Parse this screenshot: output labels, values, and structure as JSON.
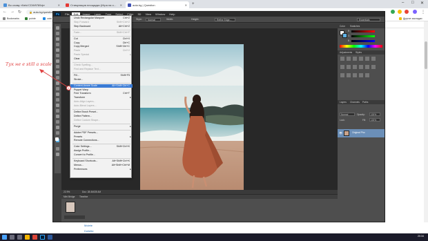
{
  "browser": {
    "tabs": [
      {
        "label": "Во славу «Nelo’CDW9789ф»",
        "color": "#4a90d9"
      },
      {
        "label": "Стимуляция площадки (Игра на о…",
        "color": "#e53935"
      },
      {
        "label": "auta.bg | Question",
        "color": "#3f51b5"
      }
    ],
    "new_tab": "+",
    "address": "auta.bg/question",
    "bookmarks": [
      {
        "label": "Bookmarks",
        "color": "#888888"
      },
      {
        "label": "pointe",
        "color": "#2e7d32"
      },
      {
        "label": "cata",
        "color": "#1e88e5"
      }
    ],
    "other_bookmarks": "Другие закладки"
  },
  "photoshop": {
    "logo": "Ps",
    "menu": [
      "File",
      "Edit",
      "Image",
      "Layer",
      "Type",
      "Select",
      "Filter",
      "3D",
      "View",
      "Window",
      "Help"
    ],
    "active_menu": "Edit",
    "options": {
      "style_label": "Style:",
      "style_value": "Normal",
      "width_label": "Width:",
      "height_label": "Height:",
      "refine_edge": "Refine Edge...",
      "workspace": "Essentials"
    },
    "status": {
      "zoom": "22.9%",
      "doc": "Doc: 28.4M/28.4M"
    },
    "bottom_tabs": [
      "Mini Bridge",
      "Timeline"
    ],
    "right_panels": {
      "color_tabs": [
        "Color",
        "Swatches"
      ],
      "rgb_values": [
        "R",
        "G",
        "B"
      ],
      "adjust_tabs": [
        "Adjustments",
        "Styles"
      ],
      "layers_tabs": [
        "Layers",
        "Channels",
        "Paths"
      ],
      "blend_mode": "Normal",
      "opacity_label": "Opacity:",
      "opacity_value": "100%",
      "lock_label": "Lock:",
      "fill_label": "Fill:",
      "fill_value": "100%",
      "layer_name": "Original Pho"
    },
    "edit_menu": [
      {
        "label": "Undo Rectangular Marquee",
        "shortcut": "Ctrl+Z",
        "state": "normal"
      },
      {
        "label": "Step Forward",
        "shortcut": "Shift+Ctrl+Z",
        "state": "disabled"
      },
      {
        "label": "Step Backward",
        "shortcut": "Alt+Ctrl+Z",
        "state": "normal"
      },
      {
        "sep": true
      },
      {
        "label": "Fade...",
        "shortcut": "Shift+Ctrl+F",
        "state": "disabled"
      },
      {
        "sep": true
      },
      {
        "label": "Cut",
        "shortcut": "Ctrl+X",
        "state": "normal"
      },
      {
        "label": "Copy",
        "shortcut": "Ctrl+C",
        "state": "normal"
      },
      {
        "label": "Copy Merged",
        "shortcut": "Shift+Ctrl+C",
        "state": "normal"
      },
      {
        "label": "Paste",
        "shortcut": "Ctrl+V",
        "state": "disabled"
      },
      {
        "label": "Paste Special",
        "shortcut": "",
        "state": "disabled",
        "submenu": true
      },
      {
        "label": "Clear",
        "shortcut": "",
        "state": "normal"
      },
      {
        "sep": true
      },
      {
        "label": "Check Spelling...",
        "shortcut": "",
        "state": "disabled"
      },
      {
        "label": "Find and Replace Text...",
        "shortcut": "",
        "state": "disabled"
      },
      {
        "sep": true
      },
      {
        "label": "Fill...",
        "shortcut": "Shift+F5",
        "state": "normal"
      },
      {
        "label": "Stroke...",
        "shortcut": "",
        "state": "normal"
      },
      {
        "sep": true
      },
      {
        "label": "Content-Aware Scale",
        "shortcut": "Alt+Shift+Ctrl+C",
        "state": "highlight"
      },
      {
        "label": "Puppet Warp",
        "shortcut": "",
        "state": "normal"
      },
      {
        "label": "Free Transform",
        "shortcut": "Ctrl+T",
        "state": "normal"
      },
      {
        "label": "Transform",
        "shortcut": "",
        "state": "normal",
        "submenu": true
      },
      {
        "label": "Auto-Align Layers...",
        "shortcut": "",
        "state": "disabled"
      },
      {
        "label": "Auto-Blend Layers...",
        "shortcut": "",
        "state": "disabled"
      },
      {
        "sep": true
      },
      {
        "label": "Define Brush Preset...",
        "shortcut": "",
        "state": "normal"
      },
      {
        "label": "Define Pattern...",
        "shortcut": "",
        "state": "normal"
      },
      {
        "label": "Define Custom Shape...",
        "shortcut": "",
        "state": "disabled"
      },
      {
        "sep": true
      },
      {
        "label": "Purge",
        "shortcut": "",
        "state": "normal",
        "submenu": true
      },
      {
        "sep": true
      },
      {
        "label": "Adobe PDF Presets...",
        "shortcut": "",
        "state": "normal"
      },
      {
        "label": "Presets",
        "shortcut": "",
        "state": "normal",
        "submenu": true
      },
      {
        "label": "Remote Connections...",
        "shortcut": "",
        "state": "normal"
      },
      {
        "sep": true
      },
      {
        "label": "Color Settings...",
        "shortcut": "Shift+Ctrl+K",
        "state": "normal"
      },
      {
        "label": "Assign Profile...",
        "shortcut": "",
        "state": "normal"
      },
      {
        "label": "Convert to Profile...",
        "shortcut": "",
        "state": "normal"
      },
      {
        "sep": true
      },
      {
        "label": "Keyboard Shortcuts...",
        "shortcut": "Alt+Shift+Ctrl+K",
        "state": "normal"
      },
      {
        "label": "Menus...",
        "shortcut": "Alt+Shift+Ctrl+M",
        "state": "normal"
      },
      {
        "label": "Preferences",
        "shortcut": "",
        "state": "normal",
        "submenu": true
      }
    ]
  },
  "annotation": {
    "text": "Тук не е still a scale",
    "step": "1",
    "color": "#e04040"
  },
  "page_links": [
    "Molete",
    "Doliette"
  ],
  "taskbar": {
    "time": "20:34",
    "date": "5.3.2021"
  }
}
